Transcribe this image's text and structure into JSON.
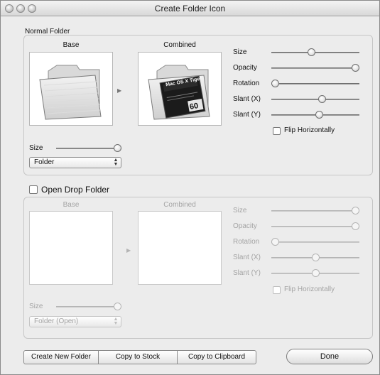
{
  "window": {
    "title": "Create Folder Icon"
  },
  "normal": {
    "group_label": "Normal Folder",
    "base_label": "Base",
    "combined_label": "Combined",
    "badge_lines": [
      "Mac OS X Tiger",
      "60"
    ],
    "sliders": [
      {
        "label": "Size",
        "value": 0.45
      },
      {
        "label": "Opacity",
        "value": 1.0
      },
      {
        "label": "Rotation",
        "value": 0.0
      },
      {
        "label": "Slant (X)",
        "value": 0.58
      },
      {
        "label": "Slant (Y)",
        "value": 0.55
      }
    ],
    "flip_label": "Flip Horizontally",
    "size_label": "Size",
    "size_value": 1.0,
    "popup_value": "Folder"
  },
  "open": {
    "checkbox_label": "Open Drop Folder",
    "base_label": "Base",
    "combined_label": "Combined",
    "sliders": [
      {
        "label": "Size",
        "value": 1.0
      },
      {
        "label": "Opacity",
        "value": 1.0
      },
      {
        "label": "Rotation",
        "value": 0.0
      },
      {
        "label": "Slant (X)",
        "value": 0.5
      },
      {
        "label": "Slant (Y)",
        "value": 0.5
      }
    ],
    "flip_label": "Flip Horizontally",
    "size_label": "Size",
    "size_value": 1.0,
    "popup_value": "Folder (Open)"
  },
  "buttons": {
    "create_new_folder": "Create New Folder",
    "copy_to_stock": "Copy to Stock",
    "copy_to_clipboard": "Copy to Clipboard",
    "done": "Done"
  },
  "icons": {
    "close": "close-icon",
    "minimize": "minimize-icon",
    "zoom": "zoom-icon",
    "arrow": "right-arrow-icon",
    "stepper": "popup-stepper-icon"
  }
}
